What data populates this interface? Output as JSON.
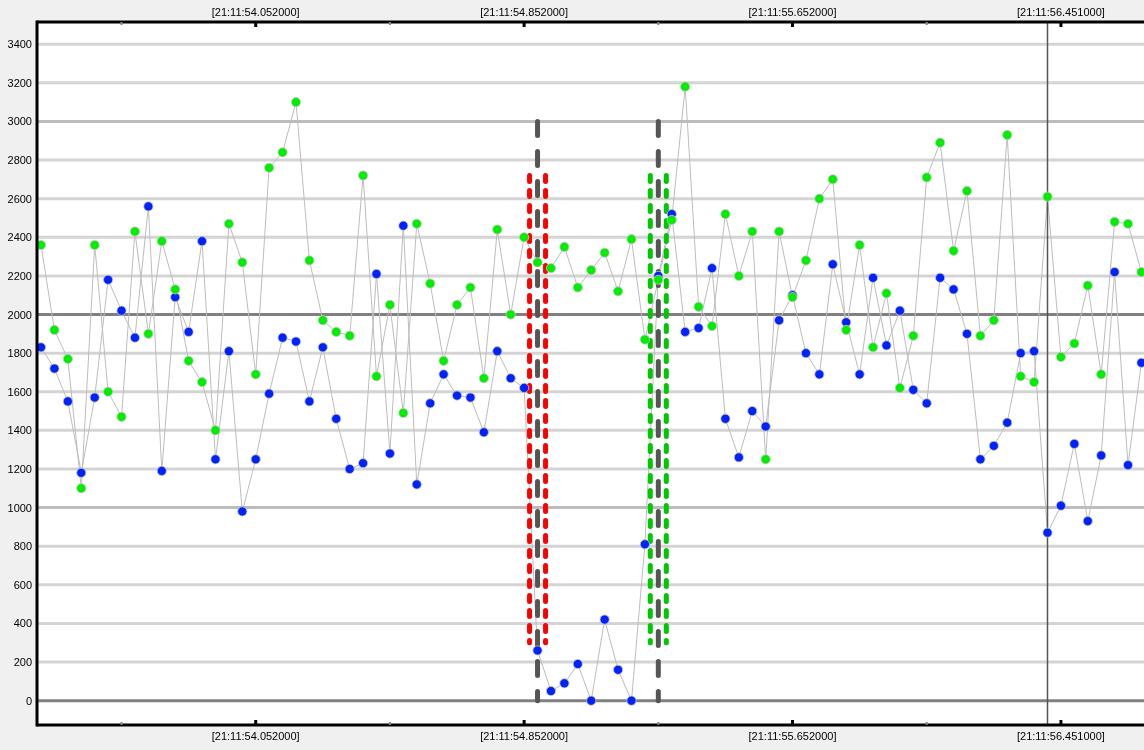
{
  "chart_data": {
    "type": "line",
    "grid": true,
    "ylim": [
      -126,
      3515
    ],
    "categories": [
      null,
      null,
      null,
      null,
      null,
      null,
      null,
      null,
      null,
      null,
      null,
      null,
      null,
      null,
      null,
      null,
      "[21:11:54.052000]",
      null,
      null,
      null,
      null,
      null,
      null,
      null,
      null,
      null,
      null,
      null,
      null,
      null,
      null,
      null,
      null,
      null,
      null,
      null,
      "[21:11:54.852000]",
      null,
      null,
      null,
      null,
      null,
      null,
      null,
      null,
      null,
      null,
      null,
      null,
      null,
      null,
      null,
      null,
      null,
      null,
      null,
      "[21:11:55.652000]",
      null,
      null,
      null,
      null,
      null,
      null,
      null,
      null,
      null,
      null,
      null,
      null,
      null,
      null,
      null,
      null,
      null,
      null,
      null,
      "[21:11:56.451000]",
      null,
      null,
      null,
      null,
      null,
      null
    ],
    "series": [
      {
        "color": "#0022ff",
        "marker": "circle",
        "values": [
          1830,
          1720,
          1550,
          1180,
          1570,
          2180,
          2020,
          1880,
          2560,
          1190,
          2090,
          1910,
          2380,
          1250,
          1810,
          980,
          1250,
          1590,
          1880,
          1860,
          1550,
          1830,
          1460,
          1200,
          1230,
          2210,
          1280,
          2460,
          1120,
          1540,
          1690,
          1580,
          1570,
          1390,
          1810,
          1670,
          1620,
          260,
          50,
          90,
          190,
          0,
          420,
          160,
          0,
          810,
          2200,
          2520,
          1910,
          1930,
          2240,
          1460,
          1260,
          1500,
          1420,
          1970,
          2100,
          1800,
          1690,
          2260,
          1960,
          1690,
          2190,
          1840,
          2020,
          1610,
          1540,
          2190,
          2130,
          1900,
          1250,
          1320,
          1440,
          1800,
          1810,
          870,
          1010,
          1330,
          930,
          1270,
          2220,
          1220,
          1750
        ]
      },
      {
        "color": "#00ee00",
        "marker": "circle",
        "values": [
          2360,
          1920,
          1770,
          1100,
          2360,
          1600,
          1470,
          2430,
          1900,
          2380,
          2130,
          1760,
          1650,
          1400,
          2470,
          2270,
          1690,
          2760,
          2840,
          3100,
          2280,
          1970,
          1910,
          1890,
          2720,
          1680,
          2050,
          1490,
          2470,
          2160,
          1760,
          2050,
          2140,
          1670,
          2440,
          2000,
          2400,
          2270,
          2240,
          2350,
          2140,
          2230,
          2320,
          2120,
          2390,
          1870,
          2180,
          2490,
          3180,
          2040,
          1940,
          2520,
          2200,
          2430,
          1250,
          2430,
          2090,
          2280,
          2600,
          2700,
          1920,
          2360,
          1830,
          2110,
          1620,
          1890,
          2710,
          2890,
          2330,
          2640,
          1890,
          1970,
          2930,
          1680,
          1650,
          2610,
          1780,
          1850,
          2150,
          1690,
          2480,
          2470,
          2220
        ]
      }
    ],
    "yticks": [
      0,
      200,
      400,
      600,
      800,
      1000,
      1200,
      1400,
      1600,
      1800,
      2000,
      2200,
      2400,
      2600,
      2800,
      3000,
      3200,
      3400
    ]
  },
  "top_axis_labels": [
    "[21:11:54.052000]",
    "[21:11:54.852000]",
    "[21:11:55.652000]",
    "[21:11:56.451000]"
  ],
  "markers": [
    {
      "kind": "dotted_pair",
      "color": "#ff0000"
    },
    {
      "kind": "dashed"
    },
    {
      "kind": "dotted_pair",
      "color": "#00c800"
    },
    {
      "kind": "dashed"
    },
    {
      "kind": "cursor"
    }
  ]
}
